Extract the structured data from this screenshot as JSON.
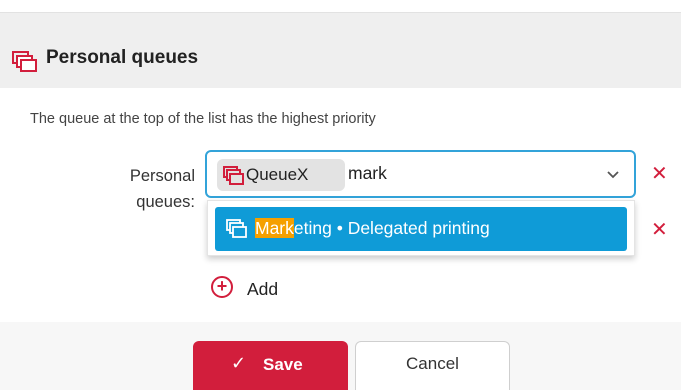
{
  "header": {
    "title": "Personal queues",
    "icon": "queue-icon"
  },
  "hint": "The queue at the top of the list has the highest priority",
  "field": {
    "label": "Personal queues:",
    "chip_label": "QueueX",
    "typed_value": "mark",
    "chip_icon": "queue-icon",
    "dropdown_icon": "chevron-down-icon"
  },
  "dropdown": {
    "option_highlight": "Mark",
    "option_rest": "eting • Delegated printing",
    "option_icon": "queue-icon"
  },
  "add": {
    "label": "Add",
    "icon": "plus-circle-icon"
  },
  "buttons": {
    "save": "Save",
    "cancel": "Cancel"
  },
  "colors": {
    "accent_red": "#d21e3c",
    "focus_blue": "#33a3d9",
    "option_blue": "#0f9bd7",
    "highlight_orange": "#f5a000"
  }
}
